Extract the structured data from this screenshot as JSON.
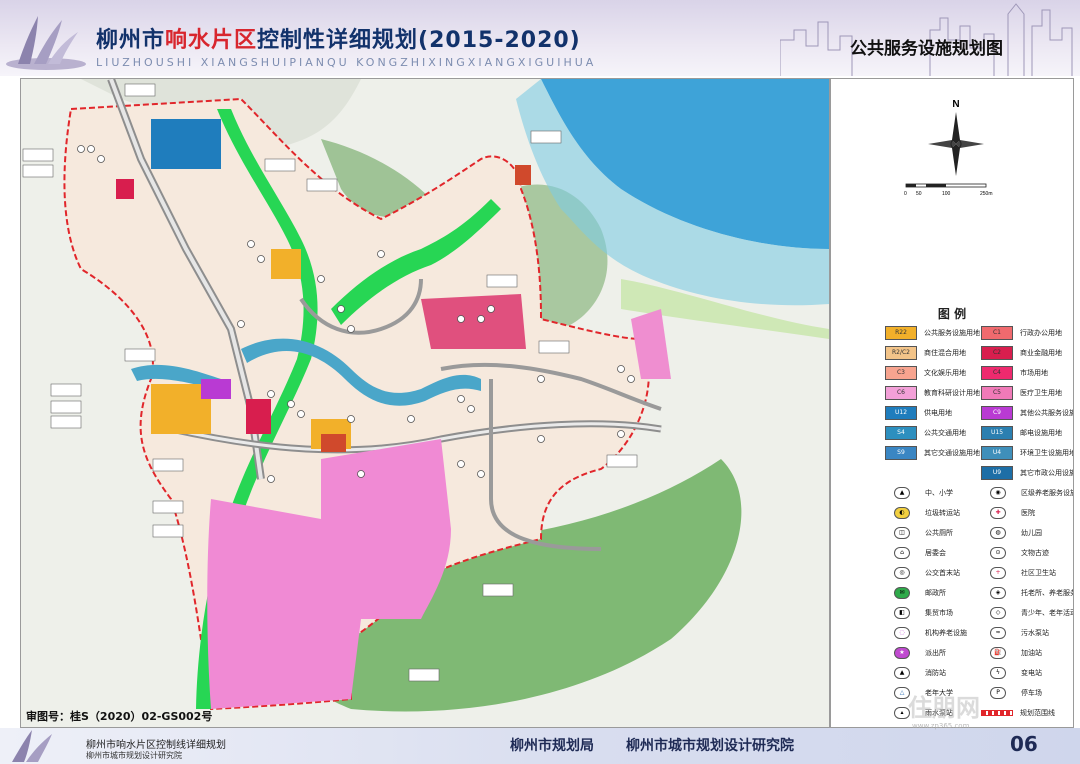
{
  "header": {
    "title_pre": "柳州市",
    "title_highlight": "响水片区",
    "title_post": "控制性详细规划(2015-2020)",
    "subtitle": "LIUZHOUSHI XIANGSHUIPIANQU KONGZHIXINGXIANGXIGUIHUA",
    "map_title": "公共服务设施规划图"
  },
  "compass": {
    "north_label": "N",
    "scale_ticks": [
      "0",
      "50",
      "100",
      "250m"
    ]
  },
  "legend": {
    "title": "图 例",
    "colors": {
      "public": "#f2b02a",
      "commercial_mixed": "#f3c489",
      "culture": "#f7a48f",
      "education": "#f3a0d8",
      "admin": "#f06a6e",
      "commerce_finance": "#d81e4e",
      "market": "#ee2a6e",
      "medical": "#f07ab8",
      "social_welfare": "#b93ad3",
      "utilities_blue": "#1f7dbd",
      "transport_blue": "#2d8fbf",
      "other_transport": "#3a86c3",
      "residential": "#f6e9dd",
      "green": "#27d654",
      "water": "#3aa3d6",
      "forest": "#76b56a"
    },
    "zones": [
      {
        "code": "R22",
        "label": "公共服务设施用地",
        "color": "#f2b02a"
      },
      {
        "code": "C1",
        "label": "行政办公用地",
        "color": "#f06a6e"
      },
      {
        "code": "R2/C2",
        "label": "商住混合用地",
        "color": "#f3c489"
      },
      {
        "code": "C2",
        "label": "商业金融用地",
        "color": "#d81e4e"
      },
      {
        "code": "C3",
        "label": "文化娱乐用地",
        "color": "#f7a48f"
      },
      {
        "code": "C4",
        "label": "市场用地",
        "color": "#ee2a6e"
      },
      {
        "code": "C6",
        "label": "教育科研设计用地",
        "color": "#f3a0d8"
      },
      {
        "code": "C5",
        "label": "医疗卫生用地",
        "color": "#f07ab8"
      },
      {
        "code": "U12",
        "label": "供电用地",
        "color": "#1f7dbd"
      },
      {
        "code": "C9",
        "label": "其他公共服务设施用地",
        "color": "#b93ad3"
      },
      {
        "code": "S4",
        "label": "公共交通用地",
        "color": "#2d8fbf"
      },
      {
        "code": "U15",
        "label": "邮电设施用地",
        "color": "#2b7fb0"
      },
      {
        "code": "S9",
        "label": "其它交通设施用地",
        "color": "#3a86c3"
      },
      {
        "code": "U4",
        "label": "环境卫生设施用地",
        "color": "#3f8fba"
      },
      {
        "code": "U9",
        "label": "其它市政公用设施用地",
        "color": "#1d6ea6"
      }
    ],
    "symbols": [
      {
        "label": "中、小学"
      },
      {
        "label": "区级养老服务设施"
      },
      {
        "label": "垃圾转运站"
      },
      {
        "label": "医院"
      },
      {
        "label": "公共厕所"
      },
      {
        "label": "幼儿园"
      },
      {
        "label": "居委会"
      },
      {
        "label": "文物古迹"
      },
      {
        "label": "公交首末站"
      },
      {
        "label": "社区卫生站"
      },
      {
        "label": "邮政所"
      },
      {
        "label": "托老所、养老服务中心"
      },
      {
        "label": "集贸市场"
      },
      {
        "label": "青少年、老年活动用房"
      },
      {
        "label": "机构养老设施"
      },
      {
        "label": "污水泵站"
      },
      {
        "label": "派出所"
      },
      {
        "label": "加油站"
      },
      {
        "label": "消防站"
      },
      {
        "label": "变电站"
      },
      {
        "label": "老年大学"
      },
      {
        "label": "停车场"
      },
      {
        "label": "雨水泵站"
      },
      {
        "label": "规划范围线"
      }
    ]
  },
  "review_number": "审图号：桂S（2020）02-GS002号",
  "footer": {
    "left_line1": "柳州市响水片区控制线详细规划",
    "left_line2": "柳州市城市规划设计研究院",
    "center_org1": "柳州市规划局",
    "center_org2": "柳州市城市规划设计研究院",
    "page_number": "06"
  },
  "watermark": {
    "text": "住朋网",
    "url": "www.zp365.com"
  }
}
